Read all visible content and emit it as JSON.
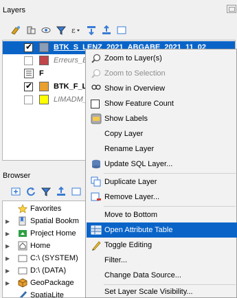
{
  "layers_panel": {
    "title": "Layers",
    "toolbar_icons": [
      "style-icon",
      "filter-layer-icon",
      "eye-icon",
      "funnel-icon",
      "expression-icon",
      "expand-icon",
      "collapse-icon",
      "remove-layer-icon"
    ],
    "items": [
      {
        "label": "BTK_S_LENZ_2021_ABGABE_2021_11_02",
        "checked": true,
        "swatch": "#8b9db7",
        "selected": true
      },
      {
        "label": "Erreurs_Et",
        "checked": false,
        "swatch": "#c0464c",
        "selected": false
      },
      {
        "label": "F",
        "checked": false,
        "swatch": "",
        "selected": false
      },
      {
        "label": "BTK_F_LE",
        "checked": true,
        "swatch": "#e8a030",
        "selected": false
      },
      {
        "label": "LIMADM_",
        "checked": false,
        "swatch": "#ffff00",
        "selected": false
      }
    ]
  },
  "browser_panel": {
    "title": "Browser",
    "items": [
      {
        "label": "Favorites",
        "icon": "star-icon"
      },
      {
        "label": "Spatial Bookm",
        "icon": "bookmark-icon"
      },
      {
        "label": "Project Home",
        "icon": "project-home-icon"
      },
      {
        "label": "Home",
        "icon": "home-icon"
      },
      {
        "label": "C:\\ (SYSTEM)",
        "icon": "drive-icon"
      },
      {
        "label": "D:\\ (DATA)",
        "icon": "drive-icon"
      },
      {
        "label": "GeoPackage",
        "icon": "geopackage-icon"
      },
      {
        "label": "SpatiaLite",
        "icon": "spatialite-icon"
      }
    ]
  },
  "context_menu": {
    "items": [
      {
        "label": "Zoom to Layer(s)",
        "icon": "zoom-layer-icon",
        "disabled": false,
        "highlight": false
      },
      {
        "label": "Zoom to Selection",
        "icon": "zoom-selection-icon",
        "disabled": true,
        "highlight": false
      },
      {
        "label": "Show in Overview",
        "icon": "overview-icon",
        "disabled": false,
        "highlight": false
      },
      {
        "label": "Show Feature Count",
        "icon": "checkbox",
        "disabled": false,
        "highlight": false
      },
      {
        "label": "Show Labels",
        "icon": "labels-icon",
        "disabled": false,
        "highlight": false
      },
      {
        "label": "Copy Layer",
        "icon": "",
        "disabled": false,
        "highlight": false
      },
      {
        "label": "Rename Layer",
        "icon": "",
        "disabled": false,
        "highlight": false
      },
      {
        "label": "Update SQL Layer...",
        "icon": "database-icon",
        "disabled": false,
        "highlight": false
      },
      {
        "label": "Duplicate Layer",
        "icon": "duplicate-icon",
        "disabled": false,
        "highlight": false
      },
      {
        "label": "Remove Layer...",
        "icon": "remove-icon",
        "disabled": false,
        "highlight": false
      },
      {
        "label": "Move to Bottom",
        "icon": "",
        "disabled": false,
        "highlight": false
      },
      {
        "label": "Open Attribute Table",
        "icon": "table-icon",
        "disabled": false,
        "highlight": true
      },
      {
        "label": "Toggle Editing",
        "icon": "pencil-icon",
        "disabled": false,
        "highlight": false
      },
      {
        "label": "Filter...",
        "icon": "",
        "disabled": false,
        "highlight": false
      },
      {
        "label": "Change Data Source...",
        "icon": "",
        "disabled": false,
        "highlight": false
      },
      {
        "label": "Set Layer Scale Visibility...",
        "icon": "",
        "disabled": false,
        "highlight": false
      }
    ]
  }
}
